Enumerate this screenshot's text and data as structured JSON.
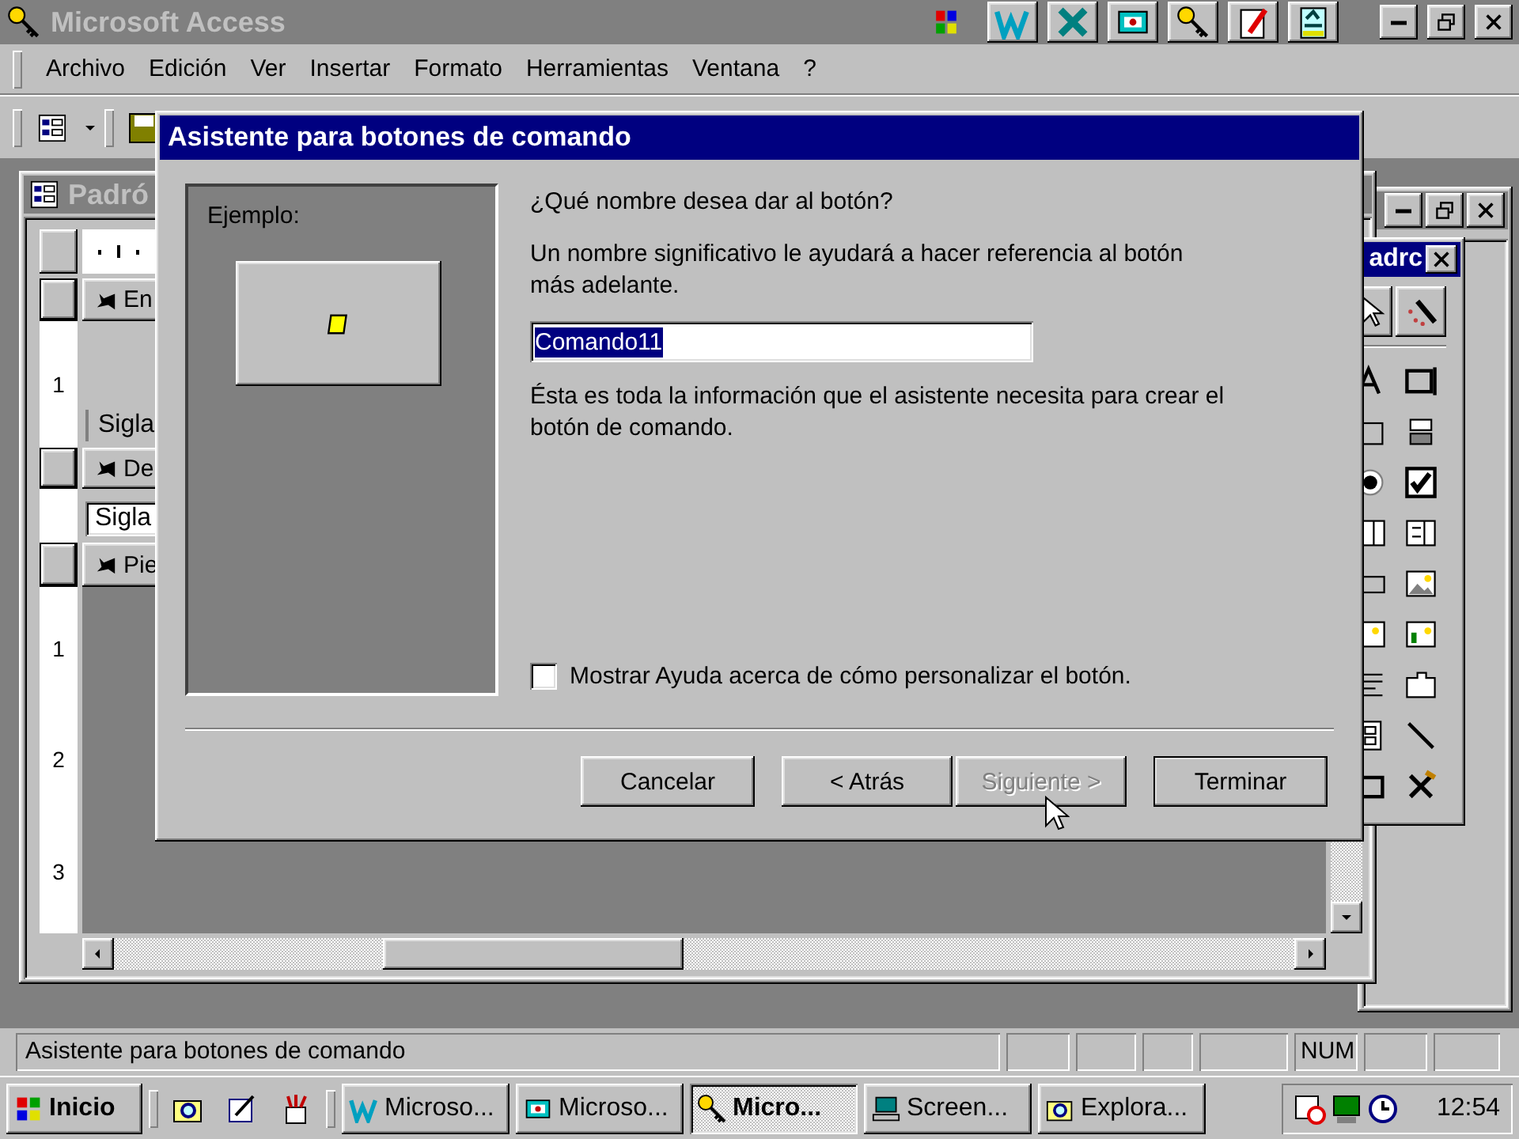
{
  "app_window": {
    "title": "Microsoft Access"
  },
  "menu": [
    {
      "label": "Archivo"
    },
    {
      "label": "Edición"
    },
    {
      "label": "Ver"
    },
    {
      "label": "Insertar"
    },
    {
      "label": "Formato"
    },
    {
      "label": "Herramientas"
    },
    {
      "label": "Ventana"
    },
    {
      "label": "?"
    }
  ],
  "form_window": {
    "title": "Padró",
    "sections": [
      {
        "label": "En",
        "ruler": [
          "1"
        ],
        "field": {
          "kind": "label",
          "text": "Sigla"
        }
      },
      {
        "label": "De",
        "field": {
          "kind": "textbox",
          "text": "Sigla"
        }
      },
      {
        "label": "Pie",
        "ruler": [
          "1",
          "2",
          "3"
        ]
      }
    ]
  },
  "toolbox": {
    "title": "adrc"
  },
  "dialog": {
    "title": "Asistente para botones de comando",
    "example_label": "Ejemplo:",
    "question": "¿Qué nombre desea dar al botón?",
    "description": "Un nombre significativo le ayudará a hacer referencia al botón más adelante.",
    "name_field": {
      "value": "Comando11",
      "text_selected": true
    },
    "info": "Ésta es toda la información que el asistente necesita para crear el botón de comando.",
    "help_checkbox": {
      "label": "Mostrar Ayuda acerca de cómo personalizar el botón.",
      "checked": false
    },
    "buttons": [
      {
        "label": "Cancelar",
        "disabled": false,
        "default": false
      },
      {
        "label": "< Atrás",
        "disabled": false,
        "default": false
      },
      {
        "label": "Siguiente >",
        "disabled": true,
        "default": false
      },
      {
        "label": "Terminar",
        "disabled": false,
        "default": true
      }
    ]
  },
  "status_bar": {
    "text": "Asistente para botones de comando",
    "indicators": [
      {
        "kind": "blank"
      },
      {
        "kind": "blank"
      },
      {
        "kind": "blank"
      },
      {
        "kind": "blank"
      },
      {
        "kind": "text",
        "label": "NUM"
      },
      {
        "kind": "blank"
      },
      {
        "kind": "blank"
      }
    ]
  },
  "taskbar": {
    "start": "Inicio",
    "tasks": [
      {
        "label": "Microso...",
        "selected": false
      },
      {
        "label": "Microso...",
        "selected": false
      },
      {
        "label": "Micro...",
        "selected": true
      },
      {
        "label": "Screen...",
        "selected": false
      },
      {
        "label": "Explora...",
        "selected": false
      }
    ],
    "clock": "12:54"
  }
}
